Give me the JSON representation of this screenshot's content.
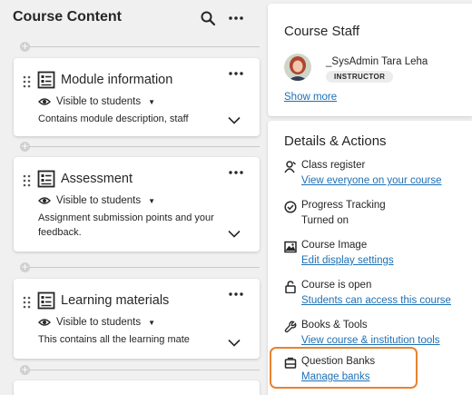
{
  "course_content": {
    "title": "Course Content",
    "header_icons": [
      "search-icon",
      "more-icon"
    ],
    "modules": [
      {
        "title": "Module information",
        "visibility": "Visible to students",
        "description": "Contains module description, staff"
      },
      {
        "title": "Assessment",
        "visibility": "Visible to students",
        "description": "Assignment submission points and your feedback."
      },
      {
        "title": "Learning materials",
        "visibility": "Visible to students",
        "description": "This contains all the learning mate"
      }
    ]
  },
  "course_staff": {
    "heading": "Course Staff",
    "staff_name": "_SysAdmin Tara Leha",
    "role": "INSTRUCTOR",
    "show_more": "Show more"
  },
  "details": {
    "heading": "Details & Actions",
    "items": [
      {
        "icon": "class-register-icon",
        "title": "Class register",
        "sub": "View everyone on your course",
        "sub_is_link": true
      },
      {
        "icon": "progress-tracking-icon",
        "title": "Progress Tracking",
        "sub": "Turned on",
        "sub_is_link": false
      },
      {
        "icon": "course-image-icon",
        "title": "Course Image",
        "sub": "Edit display settings",
        "sub_is_link": true
      },
      {
        "icon": "lock-icon",
        "title": "Course is open",
        "sub": "Students can access this course",
        "sub_is_link": true
      },
      {
        "icon": "wrench-icon",
        "title": "Books & Tools",
        "sub": "View course & institution tools",
        "sub_is_link": true
      },
      {
        "icon": "question-bank-icon",
        "title": "Question Banks",
        "sub": "Manage banks",
        "sub_is_link": true
      }
    ]
  },
  "colors": {
    "link": "#1e6fb4",
    "highlight": "#e8822f",
    "background": "#f0f0f0"
  }
}
